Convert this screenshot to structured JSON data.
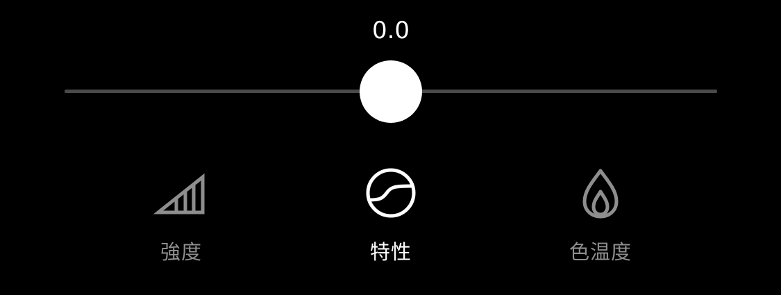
{
  "slider": {
    "value_text": "0.0",
    "position_fraction": 0.5
  },
  "tools": [
    {
      "label": "強度",
      "icon": "signal-strength-icon",
      "active": false
    },
    {
      "label": "特性",
      "icon": "s-curve-icon",
      "active": true
    },
    {
      "label": "色温度",
      "icon": "flame-icon",
      "active": false
    }
  ],
  "colors": {
    "background": "#000000",
    "active": "#ffffff",
    "inactive": "#8e8e8e",
    "track": "#4a4a4a"
  }
}
